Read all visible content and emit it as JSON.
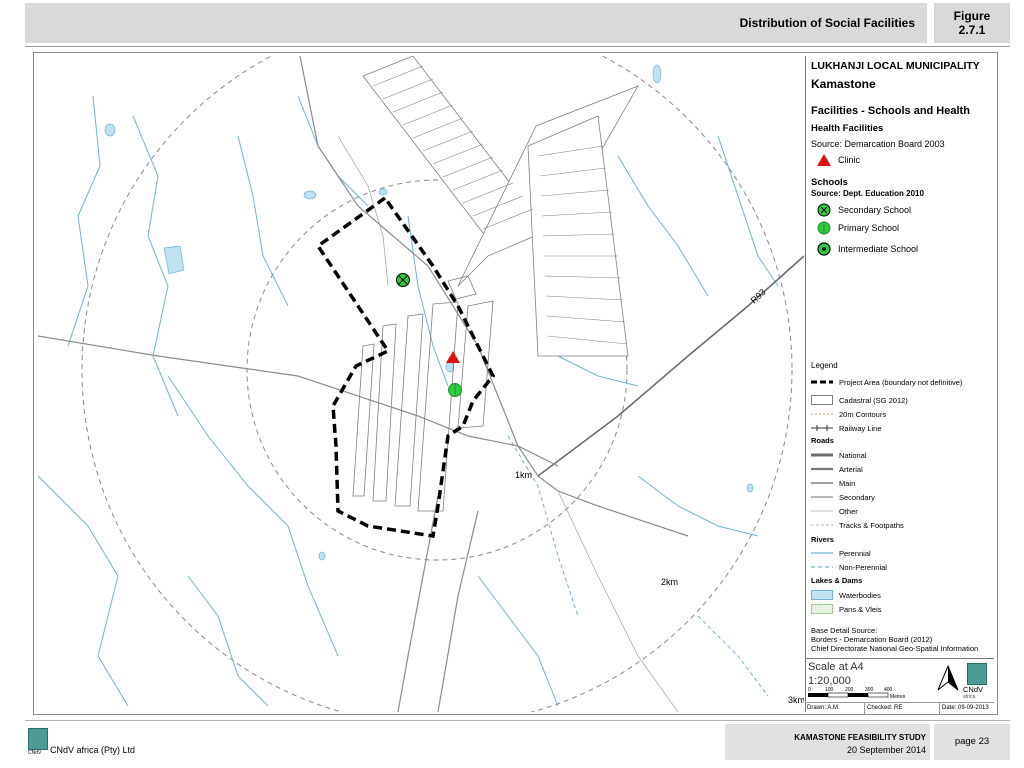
{
  "header": {
    "title": "Distribution of Social Facilities",
    "figure_label": "Figure",
    "figure_number": "2.7.1"
  },
  "map": {
    "road_label": "R93",
    "distance_labels": [
      "1km",
      "2km",
      "3km"
    ],
    "colors": {
      "rivers": "#6fb3d8",
      "waterbodies": "#bfe1f0",
      "roads": "#8c8c8c",
      "cadastral": "#7f7f7f",
      "project_boundary": "#000000",
      "clinic": "#dd1111",
      "school": "#2ecc40"
    }
  },
  "legend": {
    "municipality": "LUKHANJI LOCAL MUNICIPALITY",
    "place": "Kamastone",
    "heading": "Facilities - Schools and Health",
    "health_title": "Health Facilities",
    "health_source": "Source: Demarcation Board 2003",
    "clinic": "Clinic",
    "schools_title": "Schools",
    "schools_source": "Source: Dept. Education 2010",
    "secondary": "Secondary School",
    "primary": "Primary School",
    "intermediate": "Intermediate School",
    "legend_title": "Legend",
    "project_area": "Project Area (boundary not definitive)",
    "cadastral": "Cadastral (SG 2012)",
    "contours": "20m Contours",
    "railway": "Railway Line",
    "roads_title": "Roads",
    "national": "National",
    "arterial": "Arterial",
    "main": "Main",
    "secondary_road": "Secondary",
    "other": "Other",
    "tracks": "Tracks & Footpaths",
    "rivers_title": "Rivers",
    "perennial": "Perennial",
    "non_perennial": "Non-Perennial",
    "lakes_title": "Lakes & Dams",
    "waterbodies": "Waterbodies",
    "pans": "Pans & Vleis",
    "base_title": "Base Detail Source:",
    "base_line1": "Borders - Demarcation Board (2012)",
    "base_line2": "Chief Directorate National Geo-Spatial Information"
  },
  "scale": {
    "title": "Scale at A4",
    "ratio": "1:20,000",
    "ticks": [
      "0",
      "100",
      "200",
      "300",
      "400"
    ],
    "unit": "Metres",
    "drawn": "Drawn: A.M.",
    "checked": "Checked: RE",
    "date": "Date: 09-09-2013",
    "logo_text": "CNdV",
    "logo_sub": "africa"
  },
  "footer": {
    "company": "CNdV africa (Pty) Ltd",
    "study": "KAMASTONE FEASIBILITY STUDY",
    "date": "20 September 2014",
    "page": "page 23",
    "logo_text": "CNdV"
  }
}
